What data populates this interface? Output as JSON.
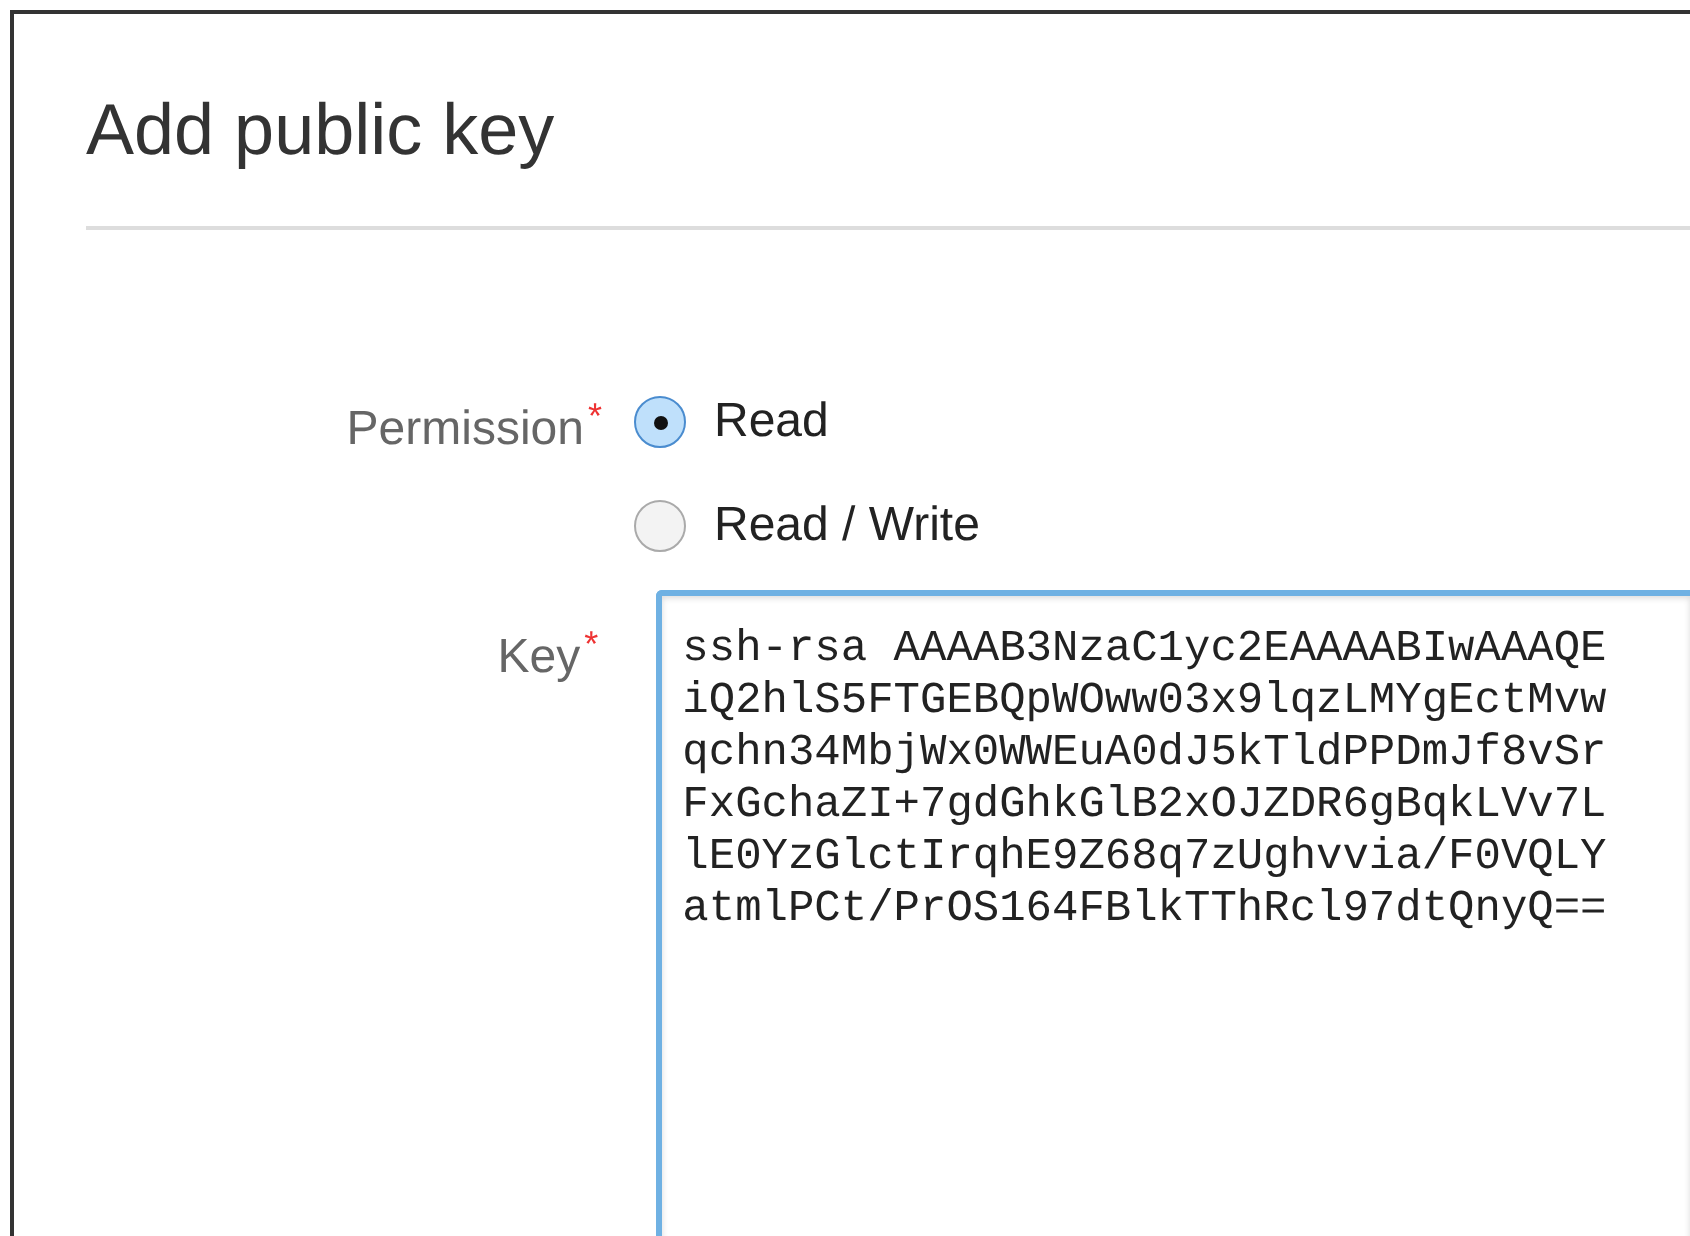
{
  "dialog": {
    "title": "Add public key"
  },
  "permission": {
    "label": "Permission",
    "required_mark": "*",
    "options": [
      {
        "label": "Read",
        "selected": true
      },
      {
        "label": "Read / Write",
        "selected": false
      }
    ]
  },
  "key": {
    "label": "Key",
    "required_mark": "*",
    "value_lines": [
      "ssh-rsa AAAAB3NzaC1yc2EAAAABIwAAAQE",
      "iQ2hlS5FTGEBQpWOww03x9lqzLMYgEctMvw",
      "qchn34MbjWx0WWEuA0dJ5kTldPPDmJf8vSr",
      "FxGchaZI+7gdGhkGlB2xOJZDR6gBqkLVv7L",
      "lE0YzGlctIrqhE9Z68q7zUghvvia/F0VQLY",
      "atmlPCt/PrOS164FBlkTThRcl97dtQnyQ=="
    ]
  }
}
